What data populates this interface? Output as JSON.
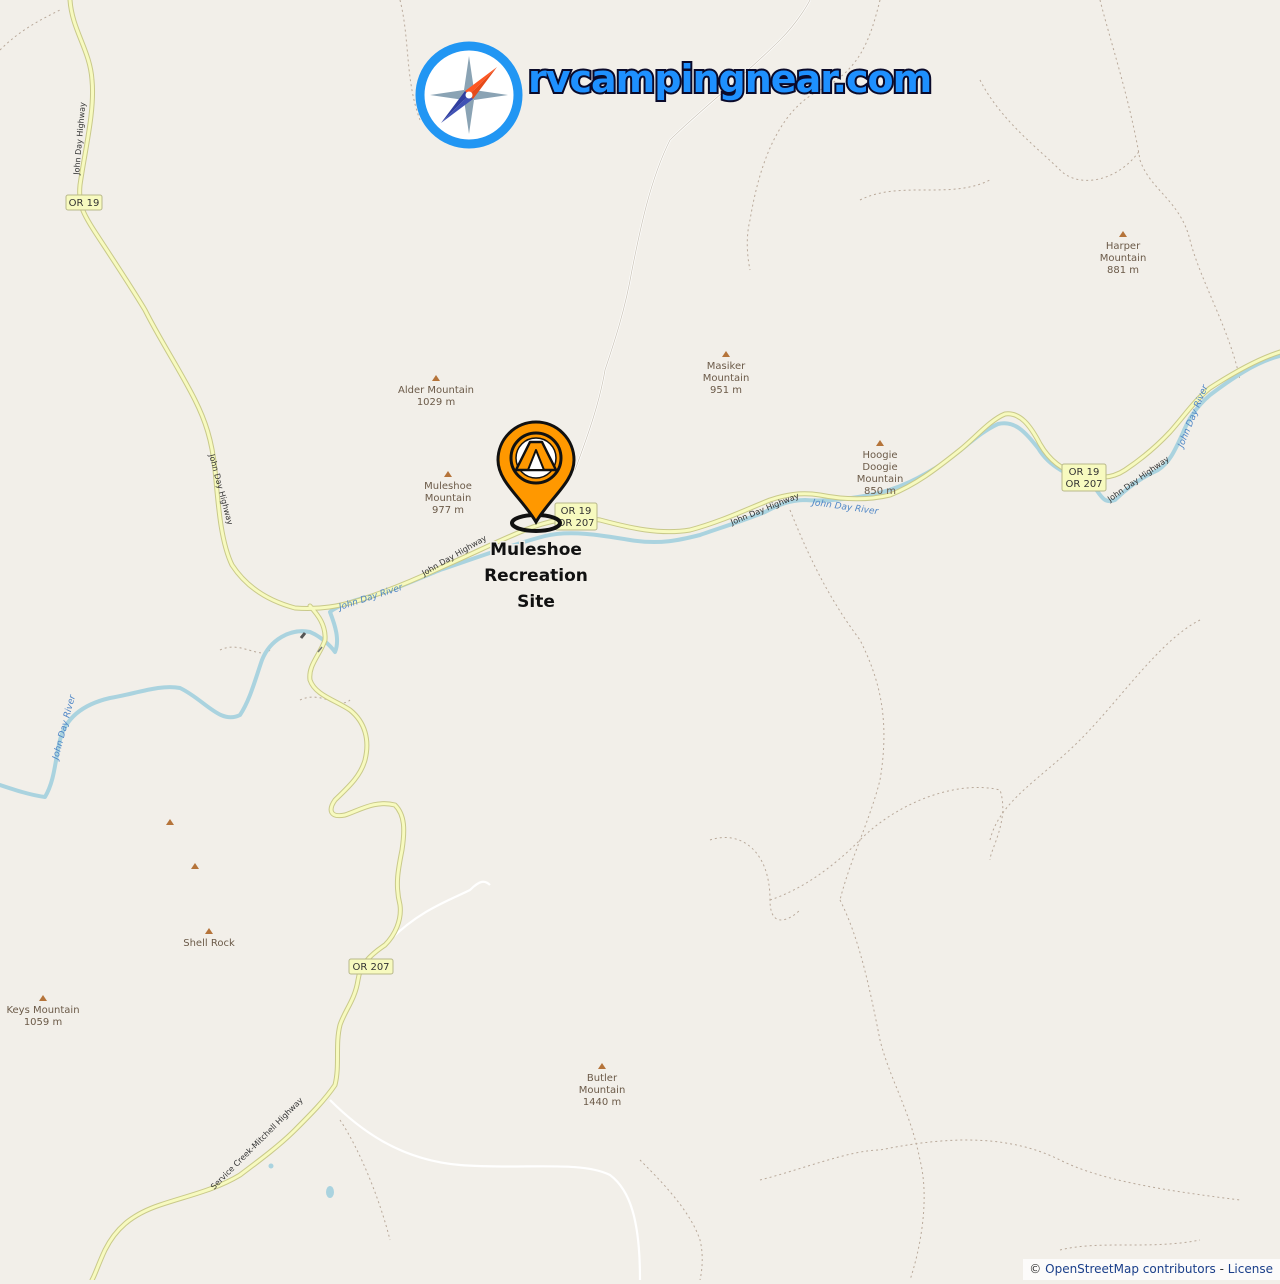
{
  "brand": {
    "logo_text": "rvcampingnear.com",
    "accent": "#1e90ff",
    "icon": "compass-icon"
  },
  "marker": {
    "label_lines": [
      "Muleshoe",
      "Recreation",
      "Site"
    ],
    "icon": "tent-pin-icon",
    "color": "#ff9800"
  },
  "peaks": [
    {
      "name": [
        "Alder Mountain"
      ],
      "elevation": "1029 m"
    },
    {
      "name": [
        "Muleshoe",
        "Mountain"
      ],
      "elevation": "977 m"
    },
    {
      "name": [
        "Masiker",
        "Mountain"
      ],
      "elevation": "951 m"
    },
    {
      "name": [
        "Hoogie",
        "Doogie",
        "Mountain"
      ],
      "elevation": "850 m"
    },
    {
      "name": [
        "Harper",
        "Mountain"
      ],
      "elevation": "881 m"
    },
    {
      "name": [
        "Shell Rock"
      ],
      "elevation": ""
    },
    {
      "name": [
        "Keys Mountain"
      ],
      "elevation": "1059 m"
    },
    {
      "name": [
        "Butler",
        "Mountain"
      ],
      "elevation": "1440 m"
    },
    {
      "name": [],
      "elevation": ""
    },
    {
      "name": [],
      "elevation": ""
    }
  ],
  "rivers": {
    "name": "John Day River"
  },
  "roads": {
    "john_day_highway": "John Day Highway",
    "service_creek": "Service Creek-Mitchell Highway"
  },
  "shields": [
    {
      "lines": [
        "OR 19"
      ]
    },
    {
      "lines": [
        "OR 19",
        "OR 207"
      ]
    },
    {
      "lines": [
        "OR 19",
        "OR 207"
      ]
    },
    {
      "lines": [
        "OR 207"
      ]
    }
  ],
  "attribution": {
    "prefix": "©",
    "osm": "OpenStreetMap contributors",
    "separator": "-",
    "license": "License"
  },
  "colors": {
    "background": "#f2efe9",
    "road": "#f7fabf",
    "road_casing": "#c9c98a",
    "river": "#aad3df",
    "peak": "#b5743a"
  }
}
